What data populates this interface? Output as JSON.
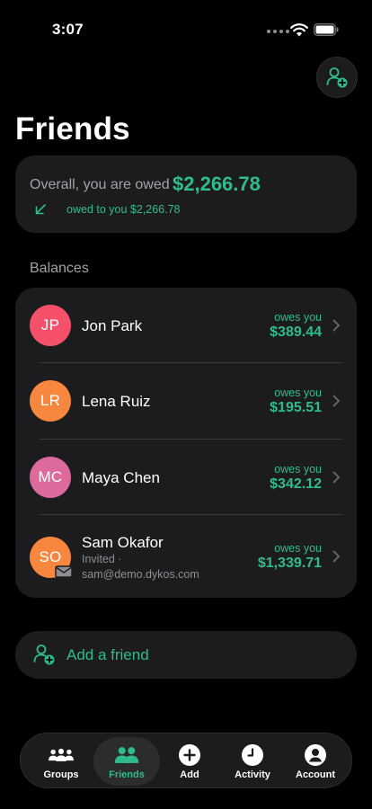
{
  "status_bar": {
    "time": "3:07"
  },
  "header": {
    "title": "Friends",
    "add_friend_icon": "person-add-icon"
  },
  "summary": {
    "label": "Overall, you are owed",
    "amount": "$2,266.78",
    "sub": "owed to you $2,266.78"
  },
  "balances": {
    "section_label": "Balances",
    "friends": [
      {
        "initials": "JP",
        "name": "Jon Park",
        "owes_label": "owes you",
        "amount": "$389.44",
        "avatar_color": "#f4506a"
      },
      {
        "initials": "LR",
        "name": "Lena Ruiz",
        "owes_label": "owes you",
        "amount": "$195.51",
        "avatar_color": "#f7863e"
      },
      {
        "initials": "MC",
        "name": "Maya Chen",
        "owes_label": "owes you",
        "amount": "$342.12",
        "avatar_color": "#dd6a9c"
      },
      {
        "initials": "SO",
        "name": "Sam Okafor",
        "status": "Invited ·",
        "email": "sam@demo.dykos.com",
        "owes_label": "owes you",
        "amount": "$1,339.71",
        "avatar_color": "#f7863e"
      }
    ]
  },
  "add_friend": {
    "label": "Add a friend"
  },
  "tabs": [
    {
      "label": "Groups",
      "icon": "groups-icon",
      "active": false
    },
    {
      "label": "Friends",
      "icon": "friends-icon",
      "active": true
    },
    {
      "label": "Add",
      "icon": "add-icon",
      "active": false
    },
    {
      "label": "Activity",
      "icon": "clock-icon",
      "active": false
    },
    {
      "label": "Account",
      "icon": "account-icon",
      "active": false
    }
  ],
  "colors": {
    "accent": "#2ebc8e",
    "card": "#1c1c1e",
    "background": "#000000"
  }
}
